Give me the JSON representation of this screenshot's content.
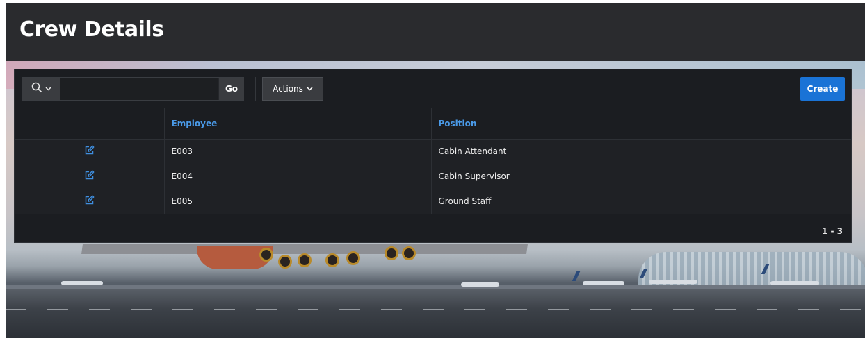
{
  "page": {
    "title": "Crew Details"
  },
  "toolbar": {
    "search_value": "",
    "search_placeholder": "",
    "go_label": "Go",
    "actions_label": "Actions",
    "create_label": "Create"
  },
  "table": {
    "columns": [
      "",
      "Employee",
      "Position"
    ],
    "rows": [
      {
        "employee": "E003",
        "position": "Cabin Attendant"
      },
      {
        "employee": "E004",
        "position": "Cabin Supervisor"
      },
      {
        "employee": "E005",
        "position": "Ground Staff"
      }
    ]
  },
  "pagination": {
    "range": "1 - 3"
  },
  "icons": {
    "search": "search-icon",
    "search_menu": "chevron-down-icon",
    "actions_menu": "chevron-down-icon",
    "edit": "edit-icon"
  },
  "colors": {
    "header_bg": "#2a2b2e",
    "region_bg": "#1b1d21",
    "accent": "#1a73d6",
    "column_header": "#4a9ae8",
    "edit_icon": "#3f8fe0"
  }
}
